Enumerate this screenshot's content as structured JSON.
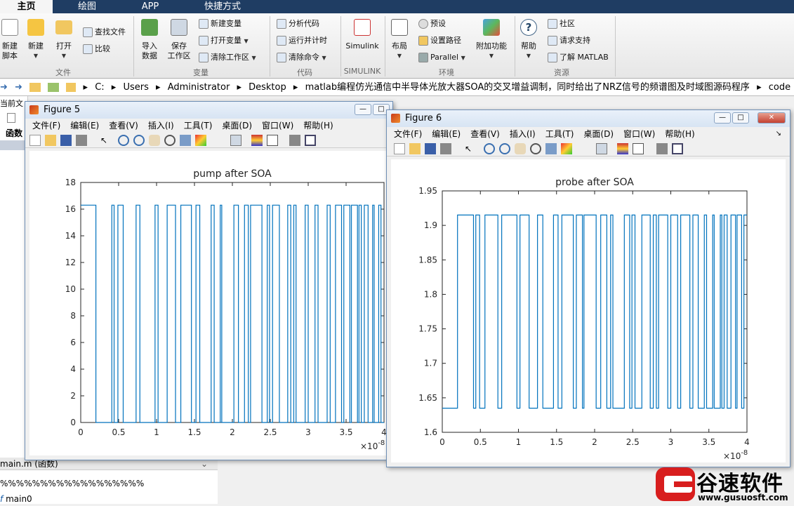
{
  "tabs": [
    "主页",
    "绘图",
    "APP",
    "快捷方式"
  ],
  "ribbon": {
    "file": {
      "new_script": [
        "新建",
        "脚本"
      ],
      "new": "新建",
      "open": "打开",
      "find_files": "查找文件",
      "compare": "比较",
      "group": "文件"
    },
    "variable": {
      "import": [
        "导入",
        "数据"
      ],
      "save": [
        "保存",
        "工作区"
      ],
      "new_var": "新建变量",
      "open_var": "打开变量",
      "clear_ws": "清除工作区",
      "group": "变量"
    },
    "code": {
      "analyze": "分析代码",
      "run_time": "运行并计时",
      "clear_cmds": "清除命令",
      "group": "代码"
    },
    "simulink": {
      "label": "Simulink",
      "group": "SIMULINK"
    },
    "env": {
      "layout": "布局",
      "prefs": "预设",
      "path": "设置路径",
      "parallel": "Parallel",
      "addons": "附加功能",
      "group": "环境"
    },
    "resources": {
      "help": "帮助",
      "community": "社区",
      "support": "请求支持",
      "learn": "了解 MATLAB",
      "group": "资源"
    }
  },
  "address": [
    "C:",
    "Users",
    "Administrator",
    "Desktop",
    "matlab编程仿光通信中半导体光放大器SOA的交叉增益调制，同时给出了NRZ信号的频谱图及时域图源码程序",
    "code"
  ],
  "left": {
    "current_folder": "当前文",
    "func": "函数",
    "file": "main.m  (函数)",
    "percent": "%%%%%%%%%%%%%%%%%%",
    "main": "main0"
  },
  "menu": [
    "文件(F)",
    "编辑(E)",
    "查看(V)",
    "插入(I)",
    "工具(T)",
    "桌面(D)",
    "窗口(W)",
    "帮助(H)"
  ],
  "fig5": {
    "title": "Figure 5"
  },
  "fig6": {
    "title": "Figure 6"
  },
  "colors": {
    "line": "#0072bd",
    "titlebar": "#1f3d63"
  },
  "chart_data": [
    {
      "type": "line",
      "title": "pump after SOA",
      "xlabel": "",
      "ylabel": "",
      "x_exponent": "×10^-8",
      "xlim": [
        0,
        4
      ],
      "ylim": [
        0,
        18
      ],
      "xticks": [
        "0",
        "0.5",
        "1",
        "1.5",
        "2",
        "2.5",
        "3",
        "3.5",
        "4"
      ],
      "yticks": [
        "0",
        "2",
        "4",
        "6",
        "8",
        "10",
        "12",
        "14",
        "16",
        "18"
      ],
      "levels": [
        0,
        16.3
      ],
      "initial_level": 16.3,
      "transitions": [
        0.2,
        0.41,
        0.44,
        0.49,
        0.56,
        0.73,
        0.78,
        0.98,
        1.02,
        1.14,
        1.25,
        1.32,
        1.46,
        1.52,
        1.57,
        1.72,
        1.76,
        1.84,
        1.86,
        2.02,
        2.08,
        2.16,
        2.21,
        2.24,
        2.39,
        2.46,
        2.49,
        2.53,
        2.62,
        2.73,
        2.77,
        2.81,
        2.84,
        2.96,
        3.0,
        3.09,
        3.13,
        3.25,
        3.29,
        3.36,
        3.44,
        3.47,
        3.55,
        3.57,
        3.65,
        3.67,
        3.7,
        3.74,
        3.79,
        3.85,
        3.87,
        3.93,
        3.96
      ]
    },
    {
      "type": "line",
      "title": "probe after SOA",
      "xlabel": "",
      "ylabel": "",
      "x_exponent": "×10^-8",
      "xlim": [
        0,
        4
      ],
      "ylim": [
        1.6,
        1.95
      ],
      "xticks": [
        "0",
        "0.5",
        "1",
        "1.5",
        "2",
        "2.5",
        "3",
        "3.5",
        "4"
      ],
      "yticks": [
        "1.6",
        "1.65",
        "1.7",
        "1.75",
        "1.8",
        "1.85",
        "1.9",
        "1.95"
      ],
      "levels": [
        1.635,
        1.915
      ],
      "initial_level": 1.635,
      "transitions": [
        0.2,
        0.41,
        0.44,
        0.49,
        0.56,
        0.73,
        0.78,
        0.98,
        1.02,
        1.14,
        1.25,
        1.32,
        1.46,
        1.52,
        1.57,
        1.72,
        1.76,
        1.84,
        1.86,
        2.02,
        2.08,
        2.16,
        2.21,
        2.24,
        2.39,
        2.46,
        2.49,
        2.53,
        2.62,
        2.73,
        2.77,
        2.81,
        2.84,
        2.96,
        3.0,
        3.09,
        3.13,
        3.25,
        3.29,
        3.36,
        3.44,
        3.47,
        3.55,
        3.57,
        3.65,
        3.67,
        3.7,
        3.74,
        3.79,
        3.85,
        3.87,
        3.93,
        3.96
      ]
    }
  ],
  "watermark": {
    "name": "谷速软件",
    "url": "www.gusuosft.com"
  }
}
